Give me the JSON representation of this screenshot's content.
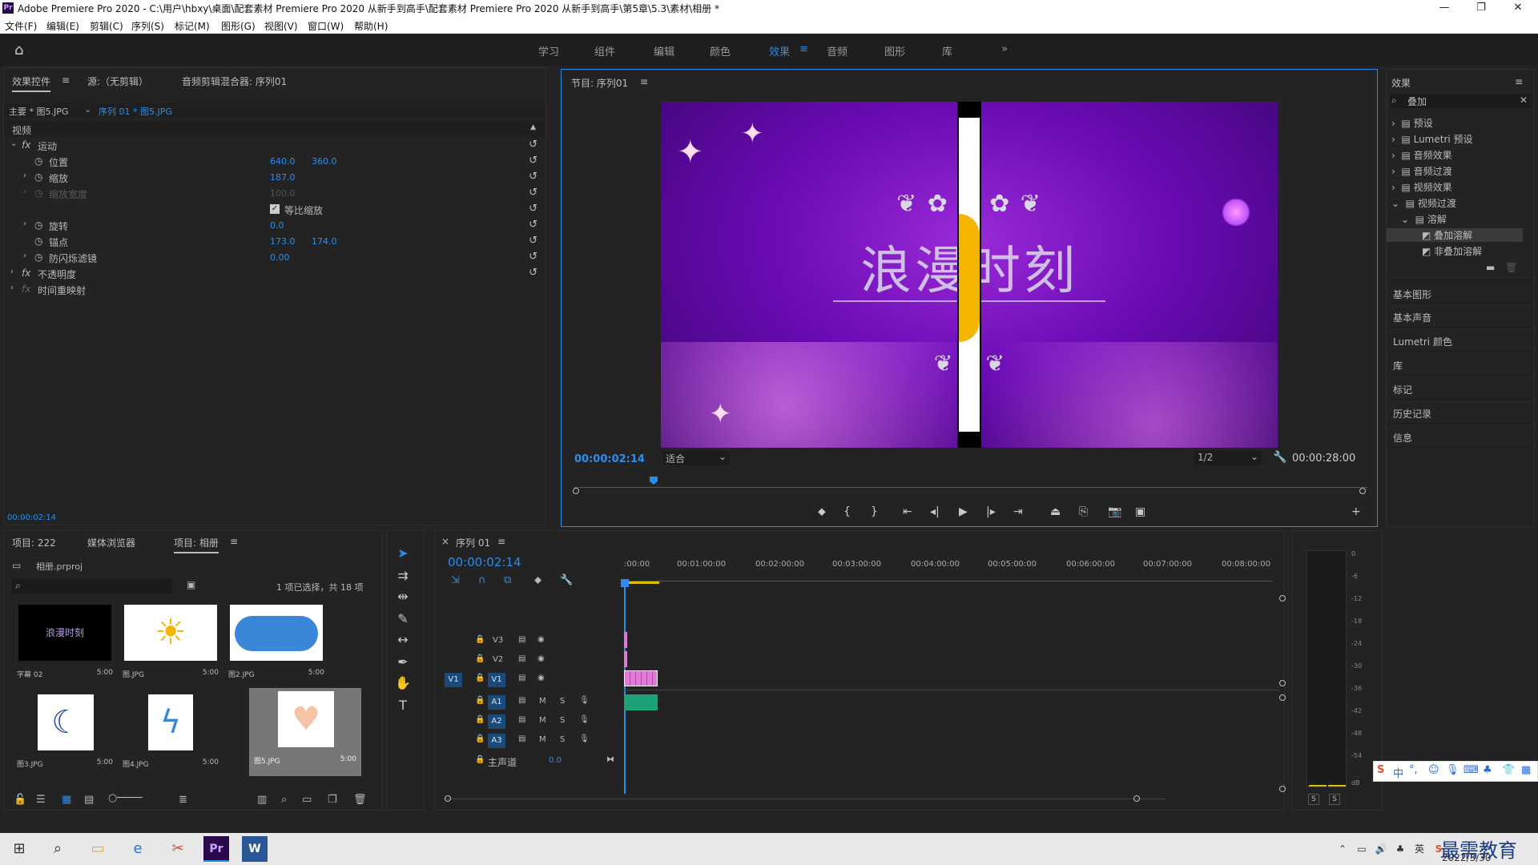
{
  "window": {
    "title": "Adobe Premiere Pro 2020 - C:\\用户\\hbxy\\桌面\\配套素材 Premiere Pro 2020 从新手到高手\\配套素材 Premiere Pro 2020 从新手到高手\\第5章\\5.3\\素材\\相册 *"
  },
  "menu": [
    "文件(F)",
    "编辑(E)",
    "剪辑(C)",
    "序列(S)",
    "标记(M)",
    "图形(G)",
    "视图(V)",
    "窗口(W)",
    "帮助(H)"
  ],
  "workspaces": [
    "学习",
    "组件",
    "编辑",
    "颜色",
    "效果",
    "音频",
    "图形",
    "库"
  ],
  "active_workspace": "效果",
  "effect_controls": {
    "tabs": [
      "效果控件",
      "源:（无剪辑）",
      "音频剪辑混合器: 序列01"
    ],
    "master": "主要 * 图5.JPG",
    "sequence": "序列 01 * 图5.JPG",
    "section_video": "视频",
    "motion": "运动",
    "props": [
      {
        "name": "位置",
        "v1": "640.0",
        "v2": "360.0"
      },
      {
        "name": "缩放",
        "v1": "187.0",
        "v2": ""
      },
      {
        "name": "缩放宽度",
        "v1": "100.0",
        "v2": ""
      },
      {
        "name": "等比缩放",
        "v1": "",
        "v2": ""
      },
      {
        "name": "旋转",
        "v1": "0.0",
        "v2": ""
      },
      {
        "name": "锚点",
        "v1": "173.0",
        "v2": "174.0"
      },
      {
        "name": "防闪烁滤镜",
        "v1": "0.00",
        "v2": ""
      }
    ],
    "opacity": "不透明度",
    "time_remap": "时间重映射",
    "timecode": "00:00:02:14"
  },
  "program": {
    "title": "节目: 序列01",
    "overlay_text": "浪漫时刻",
    "timecode": "00:00:02:14",
    "fit": "适合",
    "resolution": "1/2",
    "duration": "00:00:28:00",
    "playhead_pos": 0.1
  },
  "effects_panel": {
    "title": "效果",
    "search": "叠加",
    "tree": [
      "预设",
      "Lumetri 预设",
      "音频效果",
      "音频过渡",
      "视频效果",
      "视频过渡",
      "溶解",
      "叠加溶解",
      "非叠加溶解"
    ],
    "sections": [
      "基本图形",
      "基本声音",
      "Lumetri 颜色",
      "库",
      "标记",
      "历史记录",
      "信息"
    ]
  },
  "project": {
    "tabs": [
      "项目: 222",
      "媒体浏览器",
      "项目: 相册"
    ],
    "file": "相册.prproj",
    "selection": "1 项已选择，共 18 项",
    "items": [
      {
        "name": "字幕 02",
        "dur": "5:00",
        "text": "浪漫时刻"
      },
      {
        "name": "图.JPG",
        "dur": "5:00"
      },
      {
        "name": "图2.JPG",
        "dur": "5:00"
      },
      {
        "name": "图3.JPG",
        "dur": "5:00"
      },
      {
        "name": "图4.JPG",
        "dur": "5:00"
      },
      {
        "name": "图5.JPG",
        "dur": "5:00"
      }
    ]
  },
  "timeline": {
    "title": "序列 01",
    "timecode": "00:00:02:14",
    "ruler": [
      ":00:00",
      "00:01:00:00",
      "00:02:00:00",
      "00:03:00:00",
      "00:04:00:00",
      "00:05:00:00",
      "00:06:00:00",
      "00:07:00:00",
      "00:08:00:00"
    ],
    "video_tracks": [
      "V3",
      "V2",
      "V1"
    ],
    "audio_tracks": [
      "A1",
      "A2",
      "A3"
    ],
    "master": "主声道",
    "master_val": "0.0",
    "source_patch": "V1",
    "m": "M",
    "s": "S"
  },
  "meter": {
    "ticks": [
      "0",
      "-6",
      "-12",
      "-18",
      "-24",
      "-30",
      "-36",
      "-42",
      "-48",
      "-54",
      "dB"
    ],
    "solo": [
      "S",
      "S"
    ]
  },
  "ime": {
    "label": "中"
  },
  "taskbar": {
    "date": "2022/3/30",
    "brand": "最需教育",
    "lang": "英"
  }
}
